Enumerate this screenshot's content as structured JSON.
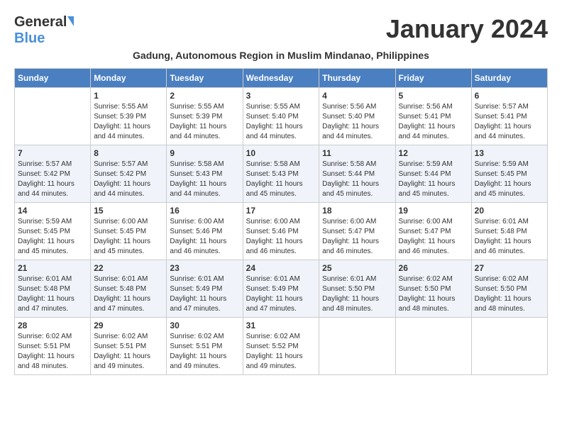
{
  "header": {
    "logo_general": "General",
    "logo_blue": "Blue",
    "month_title": "January 2024",
    "subtitle": "Gadung, Autonomous Region in Muslim Mindanao, Philippines"
  },
  "days_of_week": [
    "Sunday",
    "Monday",
    "Tuesday",
    "Wednesday",
    "Thursday",
    "Friday",
    "Saturday"
  ],
  "weeks": [
    [
      {
        "day": "",
        "info": ""
      },
      {
        "day": "1",
        "info": "Sunrise: 5:55 AM\nSunset: 5:39 PM\nDaylight: 11 hours and 44 minutes."
      },
      {
        "day": "2",
        "info": "Sunrise: 5:55 AM\nSunset: 5:39 PM\nDaylight: 11 hours and 44 minutes."
      },
      {
        "day": "3",
        "info": "Sunrise: 5:55 AM\nSunset: 5:40 PM\nDaylight: 11 hours and 44 minutes."
      },
      {
        "day": "4",
        "info": "Sunrise: 5:56 AM\nSunset: 5:40 PM\nDaylight: 11 hours and 44 minutes."
      },
      {
        "day": "5",
        "info": "Sunrise: 5:56 AM\nSunset: 5:41 PM\nDaylight: 11 hours and 44 minutes."
      },
      {
        "day": "6",
        "info": "Sunrise: 5:57 AM\nSunset: 5:41 PM\nDaylight: 11 hours and 44 minutes."
      }
    ],
    [
      {
        "day": "7",
        "info": "Sunrise: 5:57 AM\nSunset: 5:42 PM\nDaylight: 11 hours and 44 minutes."
      },
      {
        "day": "8",
        "info": "Sunrise: 5:57 AM\nSunset: 5:42 PM\nDaylight: 11 hours and 44 minutes."
      },
      {
        "day": "9",
        "info": "Sunrise: 5:58 AM\nSunset: 5:43 PM\nDaylight: 11 hours and 44 minutes."
      },
      {
        "day": "10",
        "info": "Sunrise: 5:58 AM\nSunset: 5:43 PM\nDaylight: 11 hours and 45 minutes."
      },
      {
        "day": "11",
        "info": "Sunrise: 5:58 AM\nSunset: 5:44 PM\nDaylight: 11 hours and 45 minutes."
      },
      {
        "day": "12",
        "info": "Sunrise: 5:59 AM\nSunset: 5:44 PM\nDaylight: 11 hours and 45 minutes."
      },
      {
        "day": "13",
        "info": "Sunrise: 5:59 AM\nSunset: 5:45 PM\nDaylight: 11 hours and 45 minutes."
      }
    ],
    [
      {
        "day": "14",
        "info": "Sunrise: 5:59 AM\nSunset: 5:45 PM\nDaylight: 11 hours and 45 minutes."
      },
      {
        "day": "15",
        "info": "Sunrise: 6:00 AM\nSunset: 5:45 PM\nDaylight: 11 hours and 45 minutes."
      },
      {
        "day": "16",
        "info": "Sunrise: 6:00 AM\nSunset: 5:46 PM\nDaylight: 11 hours and 46 minutes."
      },
      {
        "day": "17",
        "info": "Sunrise: 6:00 AM\nSunset: 5:46 PM\nDaylight: 11 hours and 46 minutes."
      },
      {
        "day": "18",
        "info": "Sunrise: 6:00 AM\nSunset: 5:47 PM\nDaylight: 11 hours and 46 minutes."
      },
      {
        "day": "19",
        "info": "Sunrise: 6:00 AM\nSunset: 5:47 PM\nDaylight: 11 hours and 46 minutes."
      },
      {
        "day": "20",
        "info": "Sunrise: 6:01 AM\nSunset: 5:48 PM\nDaylight: 11 hours and 46 minutes."
      }
    ],
    [
      {
        "day": "21",
        "info": "Sunrise: 6:01 AM\nSunset: 5:48 PM\nDaylight: 11 hours and 47 minutes."
      },
      {
        "day": "22",
        "info": "Sunrise: 6:01 AM\nSunset: 5:48 PM\nDaylight: 11 hours and 47 minutes."
      },
      {
        "day": "23",
        "info": "Sunrise: 6:01 AM\nSunset: 5:49 PM\nDaylight: 11 hours and 47 minutes."
      },
      {
        "day": "24",
        "info": "Sunrise: 6:01 AM\nSunset: 5:49 PM\nDaylight: 11 hours and 47 minutes."
      },
      {
        "day": "25",
        "info": "Sunrise: 6:01 AM\nSunset: 5:50 PM\nDaylight: 11 hours and 48 minutes."
      },
      {
        "day": "26",
        "info": "Sunrise: 6:02 AM\nSunset: 5:50 PM\nDaylight: 11 hours and 48 minutes."
      },
      {
        "day": "27",
        "info": "Sunrise: 6:02 AM\nSunset: 5:50 PM\nDaylight: 11 hours and 48 minutes."
      }
    ],
    [
      {
        "day": "28",
        "info": "Sunrise: 6:02 AM\nSunset: 5:51 PM\nDaylight: 11 hours and 48 minutes."
      },
      {
        "day": "29",
        "info": "Sunrise: 6:02 AM\nSunset: 5:51 PM\nDaylight: 11 hours and 49 minutes."
      },
      {
        "day": "30",
        "info": "Sunrise: 6:02 AM\nSunset: 5:51 PM\nDaylight: 11 hours and 49 minutes."
      },
      {
        "day": "31",
        "info": "Sunrise: 6:02 AM\nSunset: 5:52 PM\nDaylight: 11 hours and 49 minutes."
      },
      {
        "day": "",
        "info": ""
      },
      {
        "day": "",
        "info": ""
      },
      {
        "day": "",
        "info": ""
      }
    ]
  ]
}
